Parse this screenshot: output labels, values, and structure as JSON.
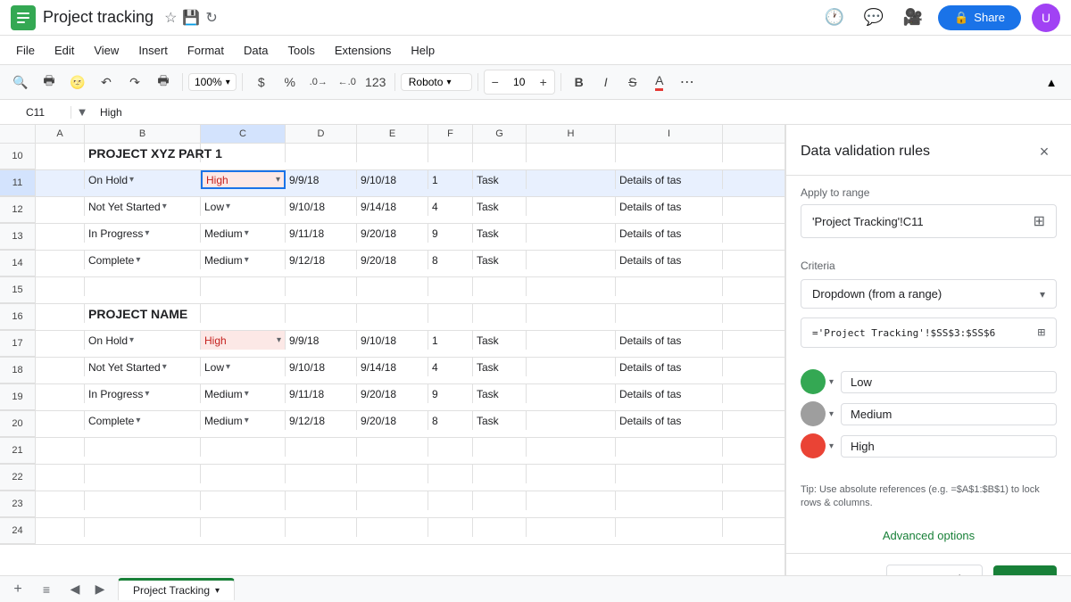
{
  "window": {
    "title": "Project tracking"
  },
  "topbar": {
    "app_logo_color": "#34a853",
    "title": "Project tracking",
    "star_icon": "★",
    "folder_icon": "📁",
    "history_icon": "⟳",
    "share_label": "Share",
    "lock_icon": "🔒"
  },
  "menu": {
    "items": [
      "File",
      "Edit",
      "View",
      "Insert",
      "Format",
      "Data",
      "Tools",
      "Extensions",
      "Help"
    ]
  },
  "toolbar": {
    "zoom": "100%",
    "currency_symbol": "$",
    "percent_symbol": "%",
    "format_123": "123",
    "font": "Roboto",
    "font_size": "10",
    "bold": "B",
    "italic": "I",
    "strikethrough": "S",
    "text_color": "A"
  },
  "formula_bar": {
    "cell_ref": "C11",
    "value": "High"
  },
  "sheet": {
    "col_headers": [
      "",
      "A",
      "B",
      "C",
      "D",
      "E",
      "F",
      "G",
      "H",
      "I"
    ],
    "rows": [
      {
        "num": 10,
        "cols": [
          "",
          "",
          "PROJECT XYZ PART 1",
          "",
          "",
          "",
          "",
          "",
          "",
          ""
        ]
      },
      {
        "num": 11,
        "cols": [
          "",
          "",
          "On Hold",
          "High",
          "9/9/18",
          "9/10/18",
          "1",
          "Task",
          "",
          "Details of tas"
        ],
        "selected_col": 2
      },
      {
        "num": 12,
        "cols": [
          "",
          "",
          "Not Yet Started",
          "Low",
          "9/10/18",
          "9/14/18",
          "4",
          "Task",
          "",
          "Details of tas"
        ]
      },
      {
        "num": 13,
        "cols": [
          "",
          "",
          "In Progress",
          "Medium",
          "9/11/18",
          "9/20/18",
          "9",
          "Task",
          "",
          "Details of tas"
        ]
      },
      {
        "num": 14,
        "cols": [
          "",
          "",
          "Complete",
          "Medium",
          "9/12/18",
          "9/20/18",
          "8",
          "Task",
          "",
          "Details of tas"
        ]
      },
      {
        "num": 15,
        "cols": [
          "",
          "",
          "",
          "",
          "",
          "",
          "",
          "",
          "",
          ""
        ]
      },
      {
        "num": 16,
        "cols": [
          "",
          "",
          "PROJECT NAME",
          "",
          "",
          "",
          "",
          "",
          "",
          ""
        ]
      },
      {
        "num": 17,
        "cols": [
          "",
          "",
          "On Hold",
          "High",
          "9/9/18",
          "9/10/18",
          "1",
          "Task",
          "",
          "Details of tas"
        ]
      },
      {
        "num": 18,
        "cols": [
          "",
          "",
          "Not Yet Started",
          "Low",
          "9/10/18",
          "9/14/18",
          "4",
          "Task",
          "",
          "Details of tas"
        ]
      },
      {
        "num": 19,
        "cols": [
          "",
          "",
          "In Progress",
          "Medium",
          "9/11/18",
          "9/20/18",
          "9",
          "Task",
          "",
          "Details of tas"
        ]
      },
      {
        "num": 20,
        "cols": [
          "",
          "",
          "Complete",
          "Medium",
          "9/12/18",
          "9/20/18",
          "8",
          "Task",
          "",
          "Details of tas"
        ]
      },
      {
        "num": 21,
        "cols": [
          "",
          "",
          "",
          "",
          "",
          "",
          "",
          "",
          "",
          ""
        ]
      },
      {
        "num": 22,
        "cols": [
          "",
          "",
          "",
          "",
          "",
          "",
          "",
          "",
          "",
          ""
        ]
      },
      {
        "num": 23,
        "cols": [
          "",
          "",
          "",
          "",
          "",
          "",
          "",
          "",
          "",
          ""
        ]
      },
      {
        "num": 24,
        "cols": [
          "",
          "",
          "",
          "",
          "",
          "",
          "",
          "",
          "",
          ""
        ]
      }
    ],
    "dropdown_rows": [
      11,
      12,
      13,
      14,
      17,
      18,
      19,
      20
    ],
    "priority_high_rows": [
      11,
      17
    ]
  },
  "bottom_bar": {
    "add_sheet_icon": "+",
    "sheet_list_icon": "≡",
    "nav_left": "◀",
    "nav_right": "▶",
    "active_sheet": "Project Tracking",
    "sheet_arrow": "▾"
  },
  "panel": {
    "title": "Data validation rules",
    "close_icon": "×",
    "apply_label": "Apply to range",
    "range_value": "'Project Tracking'!C11",
    "grid_icon": "⊞",
    "criteria_label": "Criteria",
    "criteria_value": "Dropdown (from a range)",
    "formula_value": "='Project Tracking'!$SS$3:$SS$6",
    "color_options": [
      {
        "color": "green",
        "hex": "#34a853",
        "label": "Low"
      },
      {
        "color": "gray",
        "hex": "#9e9e9e",
        "label": "Medium"
      },
      {
        "color": "red",
        "hex": "#ea4335",
        "label": "High"
      }
    ],
    "tip_text": "Tip: Use absolute references (e.g. =$A$1:$B$1) to lock rows & columns.",
    "advanced_label": "Advanced options",
    "remove_rule_label": "Remove rule",
    "done_label": "Done"
  }
}
